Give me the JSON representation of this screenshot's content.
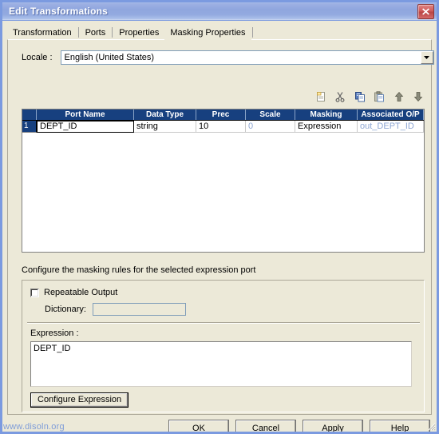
{
  "window": {
    "title": "Edit Transformations",
    "close_icon": "close-icon"
  },
  "tabs": [
    {
      "label": "Transformation",
      "active": false
    },
    {
      "label": "Ports",
      "active": false
    },
    {
      "label": "Properties",
      "active": false
    },
    {
      "label": "Masking Properties",
      "active": true
    }
  ],
  "locale": {
    "label": "Locale :",
    "value": "English (United States)",
    "placeholder": "",
    "arrow_icon": "chevron-down-icon"
  },
  "toolbar": {
    "buttons": [
      {
        "name": "new-icon",
        "tooltip": "New"
      },
      {
        "name": "cut-icon",
        "tooltip": "Cut"
      },
      {
        "name": "copy-icon",
        "tooltip": "Copy"
      },
      {
        "name": "paste-icon",
        "tooltip": "Paste"
      },
      {
        "name": "move-up-icon",
        "tooltip": "Move Up"
      },
      {
        "name": "move-down-icon",
        "tooltip": "Move Down"
      }
    ]
  },
  "grid": {
    "columns": [
      "Port Name",
      "Data Type",
      "Prec",
      "Scale",
      "Masking",
      "Associated O/P"
    ],
    "rows": [
      {
        "number": "1",
        "port_name": "DEPT_ID",
        "data_type": "string",
        "prec": "10",
        "scale": "0",
        "masking": "Expression",
        "associated_op": "out_DEPT_ID"
      }
    ]
  },
  "rules": {
    "caption": "Configure the masking rules for the selected expression port",
    "repeatable_output_label": "Repeatable Output",
    "repeatable_output_checked": false,
    "dictionary_label": "Dictionary:",
    "dictionary_value": "",
    "expression_label": "Expression :",
    "expression_value": "DEPT_ID",
    "configure_expression_label": "Configure Expression"
  },
  "footer": {
    "buttons": [
      {
        "label": "OK"
      },
      {
        "label": "Cancel"
      },
      {
        "label": "Apply"
      },
      {
        "label": "Help"
      }
    ]
  },
  "watermark": {
    "text": "www.disoln.org"
  },
  "colors": {
    "title_bar": "#8fa6de",
    "window_border": "#7b9ae0",
    "dialog_face": "#ece9d8",
    "grid_header": "#17407f",
    "readonly_text": "#8ea7d4",
    "close_button": "#cf5c5c",
    "watermark": "#7e9cd8"
  }
}
